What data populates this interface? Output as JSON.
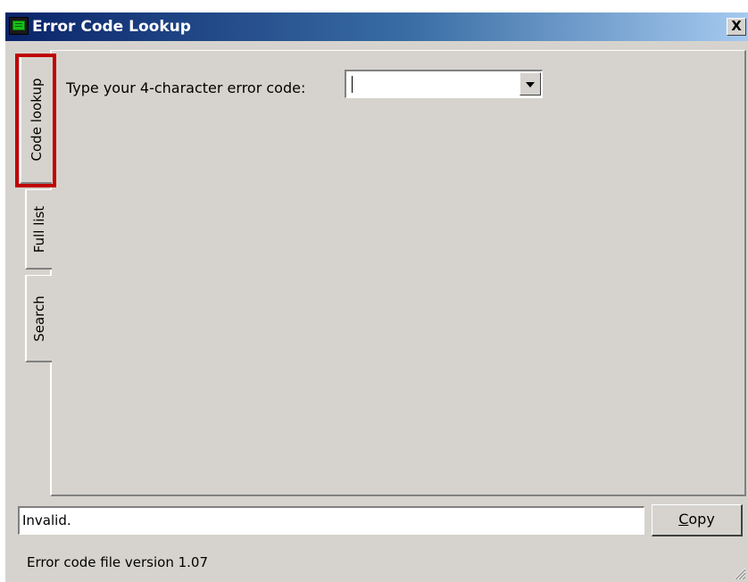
{
  "window": {
    "title": "Error Code Lookup",
    "close_label": "X"
  },
  "tabs": [
    {
      "label": "Code lookup",
      "selected": true
    },
    {
      "label": "Full list",
      "selected": false
    },
    {
      "label": "Search",
      "selected": false
    }
  ],
  "code_lookup": {
    "prompt": "Type your 4-character error code:",
    "code_value": ""
  },
  "result": {
    "value": "Invalid."
  },
  "copy_button": {
    "label_first": "C",
    "label_rest": "opy"
  },
  "status": {
    "text": "Error code file version 1.07"
  },
  "colors": {
    "highlight": "#c00000",
    "face": "#d6d3ce",
    "title_start": "#0a246a",
    "title_end": "#a6caf0"
  },
  "icons": {
    "app": "terminal-app-icon",
    "combo": "chevron-down-icon",
    "grip": "resize-grip-icon"
  }
}
